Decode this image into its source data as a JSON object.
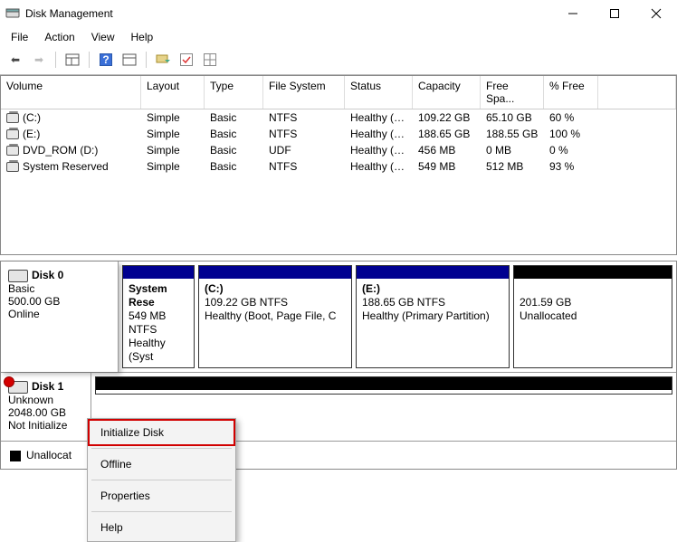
{
  "window": {
    "title": "Disk Management"
  },
  "menu": {
    "file": "File",
    "action": "Action",
    "view": "View",
    "help": "Help"
  },
  "headers": {
    "volume": "Volume",
    "layout": "Layout",
    "type": "Type",
    "fs": "File System",
    "status": "Status",
    "capacity": "Capacity",
    "free": "Free Spa...",
    "pct": "% Free"
  },
  "vols": [
    {
      "n": "(C:)",
      "l": "Simple",
      "t": "Basic",
      "fs": "NTFS",
      "s": "Healthy (B...",
      "c": "109.22 GB",
      "f": "65.10 GB",
      "p": "60 %"
    },
    {
      "n": "(E:)",
      "l": "Simple",
      "t": "Basic",
      "fs": "NTFS",
      "s": "Healthy (P...",
      "c": "188.65 GB",
      "f": "188.55 GB",
      "p": "100 %"
    },
    {
      "n": "DVD_ROM (D:)",
      "l": "Simple",
      "t": "Basic",
      "fs": "UDF",
      "s": "Healthy (P...",
      "c": "456 MB",
      "f": "0 MB",
      "p": "0 %"
    },
    {
      "n": "System Reserved",
      "l": "Simple",
      "t": "Basic",
      "fs": "NTFS",
      "s": "Healthy (S...",
      "c": "549 MB",
      "f": "512 MB",
      "p": "93 %"
    }
  ],
  "disk0": {
    "name": "Disk 0",
    "type": "Basic",
    "size": "500.00 GB",
    "state": "Online",
    "parts": [
      {
        "n": "System Rese",
        "sz": "549 MB NTFS",
        "st": "Healthy (Syst"
      },
      {
        "n": "(C:)",
        "sz": "109.22 GB NTFS",
        "st": "Healthy (Boot, Page File, C"
      },
      {
        "n": "(E:)",
        "sz": "188.65 GB NTFS",
        "st": "Healthy (Primary Partition)"
      },
      {
        "n": "",
        "sz": "201.59 GB",
        "st": "Unallocated"
      }
    ]
  },
  "disk1": {
    "name": "Disk 1",
    "type": "Unknown",
    "size": "2048.00 GB",
    "state": "Not Initialize"
  },
  "legend": {
    "unalloc": "Unallocat"
  },
  "ctx": {
    "init": "Initialize Disk",
    "off": "Offline",
    "prop": "Properties",
    "help": "Help"
  }
}
